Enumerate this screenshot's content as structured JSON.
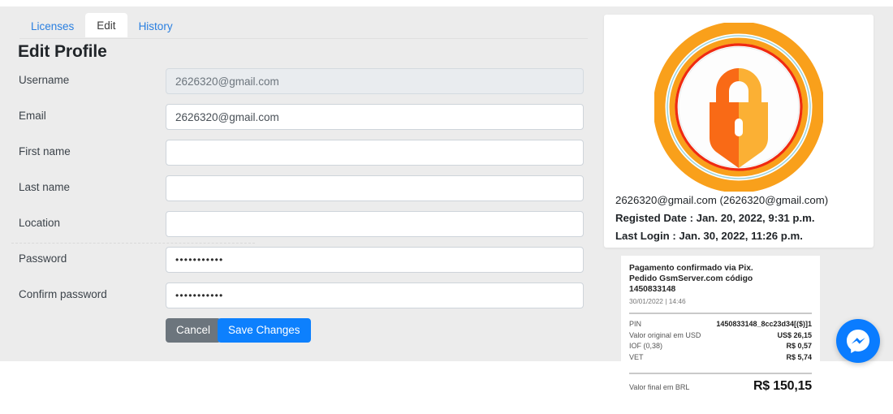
{
  "tabs": [
    {
      "label": "Licenses",
      "active": false
    },
    {
      "label": "Edit",
      "active": true
    },
    {
      "label": "History",
      "active": false
    }
  ],
  "page_title": "Edit Profile",
  "form": {
    "fields": [
      {
        "label": "Username",
        "value": "2626320@gmail.com",
        "type": "text",
        "disabled": true
      },
      {
        "label": "Email",
        "value": "2626320@gmail.com",
        "type": "text",
        "disabled": false
      },
      {
        "label": "First name",
        "value": "",
        "type": "text",
        "disabled": false
      },
      {
        "label": "Last name",
        "value": "",
        "type": "text",
        "disabled": false
      },
      {
        "label": "Location",
        "value": "",
        "type": "text",
        "disabled": false
      },
      {
        "label": "Password",
        "value": "•••••••••••",
        "type": "password",
        "disabled": false
      },
      {
        "label": "Confirm password",
        "value": "•••••••••••",
        "type": "password",
        "disabled": false
      }
    ],
    "cancel_label": "Cancel",
    "save_label": "Save Changes"
  },
  "profile": {
    "avatar_icon": "lock-avatar-icon",
    "identity": "2626320@gmail.com (2626320@gmail.com)",
    "registered": "Registed Date : Jan. 20, 2022, 9:31 p.m.",
    "last_login": "Last Login : Jan. 30, 2022, 11:26 p.m."
  },
  "receipt": {
    "title_line1": "Pagamento confirmado via Pix.",
    "title_line2": "Pedido GsmServer.com código",
    "code": "1450833148",
    "datetime": "30/01/2022 | 14:46",
    "rows": [
      {
        "label": "PIN",
        "value": "1450833148_8cc23d34[($)]1"
      },
      {
        "label": "Valor original em USD",
        "value": "US$ 26,15"
      },
      {
        "label": "IOF (0,38)",
        "value": "R$ 0,57"
      },
      {
        "label": "VET",
        "value": "R$ 5,74"
      }
    ],
    "total_label": "Valor final em BRL",
    "total_value": "R$ 150,15"
  },
  "messenger": {
    "icon": "messenger-icon"
  },
  "colors": {
    "accent_blue": "#0d80fd",
    "link_blue": "#2a7fe0",
    "gray_button": "#6c757d",
    "page_bg": "#ececec",
    "avatar_orange": "#f9a01b",
    "avatar_red": "#ef2b11",
    "messenger_blue": "#0a7cff"
  }
}
